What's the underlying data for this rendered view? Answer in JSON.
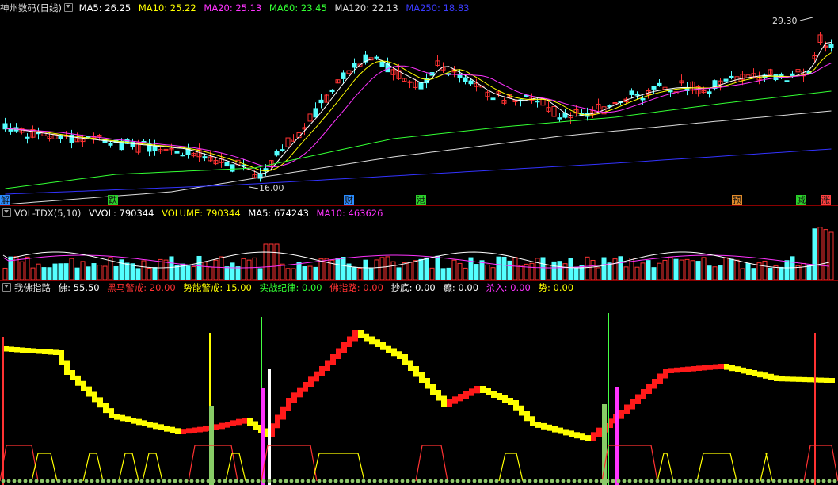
{
  "main_legend": {
    "title": "神州数码(日线)",
    "ma5": "MA5: 26.25",
    "ma10": "MA10: 25.22",
    "ma20": "MA20: 25.13",
    "ma60": "MA60: 23.45",
    "ma120": "MA120: 22.13",
    "ma250": "MA250: 18.83"
  },
  "price_high_label": "29.30",
  "price_low_label": "16.00",
  "signals": [
    {
      "text": "解",
      "color": "#2a8cff"
    },
    {
      "text": "跌",
      "color": "#2bd12b"
    },
    {
      "text": "财",
      "color": "#2a8cff"
    },
    {
      "text": "港",
      "color": "#2bd12b"
    },
    {
      "text": "预",
      "color": "#e08a2a"
    },
    {
      "text": "减",
      "color": "#2bd12b"
    },
    {
      "text": "涨",
      "color": "#ff4040"
    }
  ],
  "vol_legend": {
    "title": "VOL-TDX(5,10)",
    "vvol": "VVOL: 790344",
    "volume": "VOLUME: 790344",
    "ma5": "MA5: 674243",
    "ma10": "MA10: 463626"
  },
  "ind_legend": {
    "title": "我佛指路",
    "fo": "佛: 55.50",
    "heima": "黑马警戒: 20.00",
    "shineng": "势能警戒: 15.00",
    "shizhan": "实战纪律: 0.00",
    "fozhilu": "佛指路: 0.00",
    "chaodi": "抄底: 0.00",
    "dian": "癫: 0.00",
    "sharu": "杀入: 0.00",
    "shi": "势: 0.00"
  },
  "colors": {
    "up": "#ff3232",
    "down": "#54ffff",
    "ma5": "#ffffff",
    "ma10": "#ffff00",
    "ma20": "#ff33ff",
    "ma60": "#33ff33",
    "ma120": "#dddddd",
    "ma250": "#3333ff"
  }
}
